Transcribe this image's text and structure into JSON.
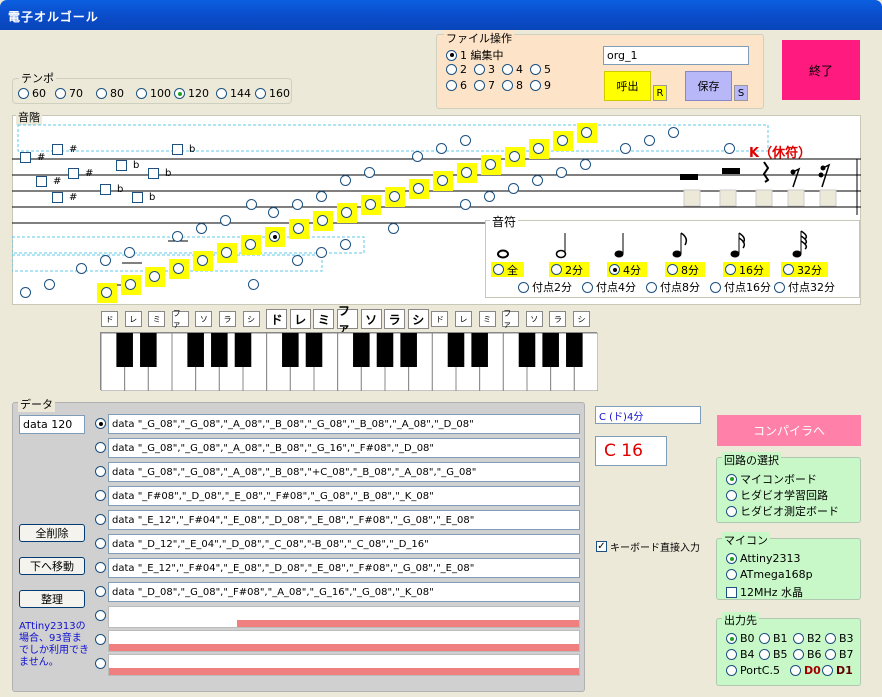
{
  "title": "電子オルゴール",
  "tempo": {
    "legend": "テンポ",
    "options": [
      "60",
      "70",
      "80",
      "100",
      "120",
      "144",
      "160"
    ],
    "selected": "120"
  },
  "file": {
    "legend": "ファイル操作",
    "editing_label": "1 編集中",
    "slots": [
      "2",
      "3",
      "4",
      "5",
      "6",
      "7",
      "8",
      "9"
    ],
    "filename": "org_1",
    "call_label": "呼出",
    "call_key": "R",
    "save_label": "保存",
    "save_key": "S"
  },
  "exit_label": "終了",
  "score": {
    "legend": "音階",
    "rest_label": "K（休符）",
    "sharp": "#",
    "flat": "b"
  },
  "note_length": {
    "legend": "音符",
    "options": [
      "全",
      "2分",
      "4分",
      "8分",
      "16分",
      "32分"
    ],
    "selected": "4分",
    "dotted": [
      "付点2分",
      "付点4分",
      "付点8分",
      "付点16分",
      "付点32分"
    ]
  },
  "keys": {
    "labels": [
      "ド",
      "レ",
      "ミ",
      "ファ",
      "ソ",
      "ラ",
      "シ",
      "ド",
      "レ",
      "ミ",
      "ファ",
      "ソ",
      "ラ",
      "シ",
      "ド",
      "レ",
      "ミ",
      "ファ",
      "ソ",
      "ラ",
      "シ"
    ]
  },
  "data_panel": {
    "legend": "データ",
    "current": "data 120",
    "clear_all_label": "全削除",
    "move_down_label": "下へ移動",
    "arrange_label": "整理",
    "note": "ATtiny2313の場合、93音までしか利用できません。",
    "lines": [
      "data \"_G_08\",\"_G_08\",\"_A_08\",\"_B_08\",\"_G_08\",\"_B_08\",\"_A_08\",\"_D_08\"",
      "data \"_G_08\",\"_G_08\",\"_A_08\",\"_B_08\",\"_G_16\",\"_F#08\",\"_D_08\"",
      "data \"_G_08\",\"_G_08\",\"_A_08\",\"_B_08\",\"+C_08\",\"_B_08\",\"_A_08\",\"_G_08\"",
      "data \"_F#08\",\"_D_08\",\"_E_08\",\"_F#08\",\"_G_08\",\"_B_08\",\"_K_08\"",
      "data \"_E_12\",\"_F#04\",\"_E_08\",\"_D_08\",\"_E_08\",\"_F#08\",\"_G_08\",\"_E_08\"",
      "data \"_D_12\",\"_E_04\",\"_D_08\",\"_C_08\",\"-B_08\",\"_C_08\",\"_D_16\"",
      "data \"_E_12\",\"_F#04\",\"_E_08\",\"_D_08\",\"_E_08\",\"_F#08\",\"_G_08\",\"_E_08\"",
      "data \"_D_08\",\"_G_08\",\"_F#08\",\"_A_08\",\"_G_16\",\"_G_08\",\"_K_08\""
    ]
  },
  "current_note": "C (ド)4分",
  "current_code": "C 16",
  "keyboard_input_label": "キーボード直接入力",
  "compile_label": "コンパイラへ",
  "circuit": {
    "legend": "回路の選択",
    "options": [
      "マイコンボード",
      "ヒダビオ学習回路",
      "ヒダビオ測定ボード"
    ],
    "selected": "マイコンボード"
  },
  "mcu": {
    "legend": "マイコン",
    "options": [
      "Attiny2313",
      "ATmega168p"
    ],
    "selected": "Attiny2313",
    "crystal_label": "12MHz 水晶"
  },
  "output": {
    "legend": "出力先",
    "options": [
      "B0",
      "B1",
      "B2",
      "B3",
      "B4",
      "B5",
      "B6",
      "B7",
      "PortC.5",
      "D0",
      "D1"
    ],
    "selected": "B0"
  },
  "colors": {
    "titlebar": "#0a4ac8",
    "exit": "#ff1a7f",
    "compile": "#ff80a8",
    "call": "#ffff00",
    "save": "#b8b8f8",
    "file_panel": "#fde4c8",
    "green_panel": "#c8f8c8",
    "data_panel": "#d8d8d8",
    "highlight": "#ffff00",
    "scroll_fill": "#f08080"
  }
}
